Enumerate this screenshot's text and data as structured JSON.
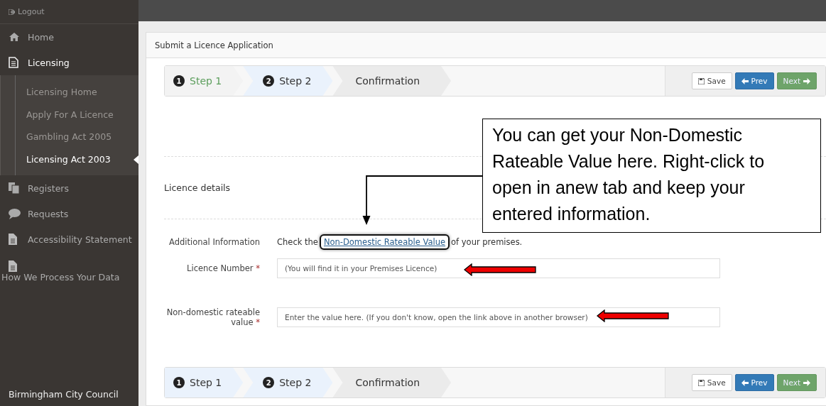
{
  "sidebar": {
    "logout": "Logout",
    "items": [
      {
        "label": "Home",
        "kind": "inline",
        "expanded": false
      },
      {
        "label": "Licensing",
        "kind": "inline",
        "expanded": true,
        "children": [
          {
            "label": "Licensing Home",
            "selected": false
          },
          {
            "label": "Apply For A Licence",
            "selected": false
          },
          {
            "label": "Gambling Act 2005",
            "selected": false
          },
          {
            "label": "Licensing Act 2003",
            "selected": true
          }
        ]
      },
      {
        "label": "Registers",
        "kind": "inline",
        "expanded": false
      },
      {
        "label": "Requests",
        "kind": "inline",
        "expanded": false
      },
      {
        "label": "Accessibility Statement",
        "kind": "inline",
        "expanded": false
      },
      {
        "label": "How We Process Your Data",
        "kind": "stacked",
        "expanded": false
      }
    ],
    "footer": "Birmingham City Council"
  },
  "panel": {
    "title": "Submit a Licence Application"
  },
  "wizards": [
    {
      "steps": [
        {
          "number": "1",
          "label": "Step 1",
          "completed": true,
          "selected": false
        },
        {
          "number": "2",
          "label": "Step 2",
          "completed": false,
          "selected": true
        },
        {
          "label": "Confirmation",
          "completed": false,
          "selected": false
        }
      ],
      "buttons": [
        {
          "label": "Save",
          "kind": "save"
        },
        {
          "label": "Prev",
          "kind": "prev"
        },
        {
          "label": "Next",
          "kind": "next"
        }
      ]
    },
    {
      "steps": [
        {
          "number": "1",
          "label": "Step 1",
          "completed": false,
          "selected": true
        },
        {
          "number": "2",
          "label": "Step 2",
          "completed": false,
          "selected": true
        },
        {
          "label": "Confirmation",
          "completed": false,
          "selected": false
        }
      ],
      "buttons": [
        {
          "label": "Save",
          "kind": "save"
        },
        {
          "label": "Prev",
          "kind": "prev"
        },
        {
          "label": "Next",
          "kind": "next"
        }
      ]
    }
  ],
  "section_title": "Licence details",
  "info": {
    "label": "Additional Information",
    "before": "Check the",
    "link": "Non-Domestic Rateable Value",
    "after": "of your premises.",
    "link_highlighted": true
  },
  "fields": [
    {
      "label": "Licence Number",
      "required_mark": "*",
      "placeholder": "(You will find it in your Premises Licence)",
      "pointer_arrow": true
    },
    {
      "label": "Non-domestic rateable value",
      "required_mark": "*",
      "placeholder": "Enter the value here. (If you don't know, open the link above in another browser)",
      "pointer_arrow": true
    }
  ],
  "callout": {
    "text": "You can get your Non-Domestic Rateable Value here. Right-click to open in anew tab and keep your entered information."
  }
}
